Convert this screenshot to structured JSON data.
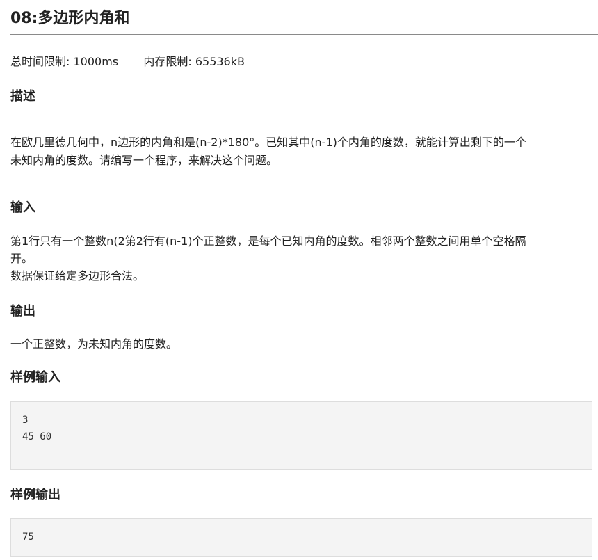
{
  "problem": {
    "title": "08:多边形内角和",
    "limits": {
      "time_label": "总时间限制:",
      "time_value": "1000ms",
      "memory_label": "内存限制:",
      "memory_value": "65536kB"
    },
    "description": {
      "heading": "描述",
      "line1": "在欧几里德几何中，n边形的内角和是(n-2)*180°。已知其中(n-1)个内角的度数，就能计算出剩下的一个",
      "line2": "未知内角的度数。请编写一个程序，来解决这个问题。"
    },
    "input": {
      "heading": "输入",
      "line1": "第1行只有一个整数n(2第2行有(n-1)个正整数，是每个已知内角的度数。相邻两个整数之间用单个空格隔",
      "line2": "开。",
      "line3": "数据保证给定多边形合法。"
    },
    "output": {
      "heading": "输出",
      "line1": "一个正整数，为未知内角的度数。"
    },
    "sample_input": {
      "heading": "样例输入",
      "content": "3\n45 60"
    },
    "sample_output": {
      "heading": "样例输出",
      "content": "75"
    }
  }
}
